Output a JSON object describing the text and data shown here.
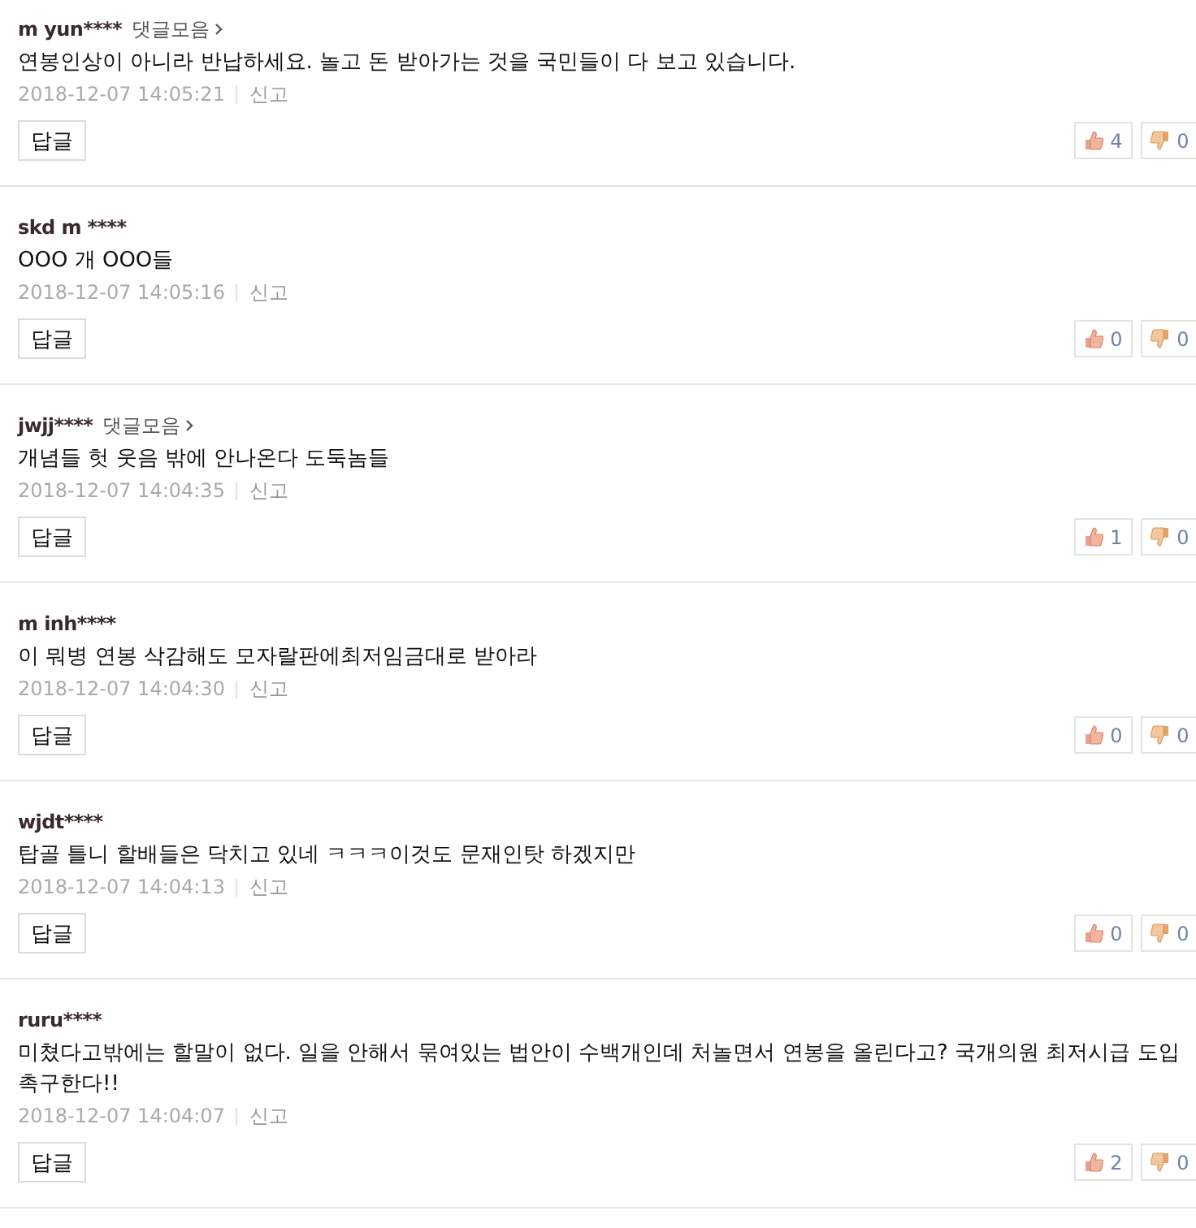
{
  "comments": [
    {
      "user": "m yun****",
      "collection_link": "댓글모음",
      "text": "연봉인상이 아니라 반납하세요. 놀고 돈 받아가는 것을 국민들이 다 보고 있습니다.",
      "date": "2018-12-07 14:05:21",
      "report": "신고",
      "reply": "답글",
      "likes": "4",
      "dislikes": "0"
    },
    {
      "user": "skd m ****",
      "text": "OOO 개 OOO들",
      "date": "2018-12-07 14:05:16",
      "report": "신고",
      "reply": "답글",
      "likes": "0",
      "dislikes": "0"
    },
    {
      "user": "jwjj****",
      "collection_link": "댓글모음",
      "text": "개념들 헛 웃음 밖에 안나온다 도둑놈들",
      "date": "2018-12-07 14:04:35",
      "report": "신고",
      "reply": "답글",
      "likes": "1",
      "dislikes": "0"
    },
    {
      "user": "m inh****",
      "text": "이 뭐병 연봉 삭감해도 모자랄판에최저임금대로 받아라",
      "date": "2018-12-07 14:04:30",
      "report": "신고",
      "reply": "답글",
      "likes": "0",
      "dislikes": "0"
    },
    {
      "user": "wjdt****",
      "text": "탑골 틀니 할배들은 닥치고 있네 ㅋㅋㅋ이것도 문재인탓 하겠지만",
      "date": "2018-12-07 14:04:13",
      "report": "신고",
      "reply": "답글",
      "likes": "0",
      "dislikes": "0"
    },
    {
      "user": "ruru****",
      "text": "미쳤다고밖에는 할말이 없다. 일을 안해서 묶여있는 법안이 수백개인데 처놀면서 연봉을 올린다고? 국개의원 최저시급 도입 촉구한다!!",
      "date": "2018-12-07 14:04:07",
      "report": "신고",
      "reply": "답글",
      "likes": "2",
      "dislikes": "0"
    }
  ]
}
